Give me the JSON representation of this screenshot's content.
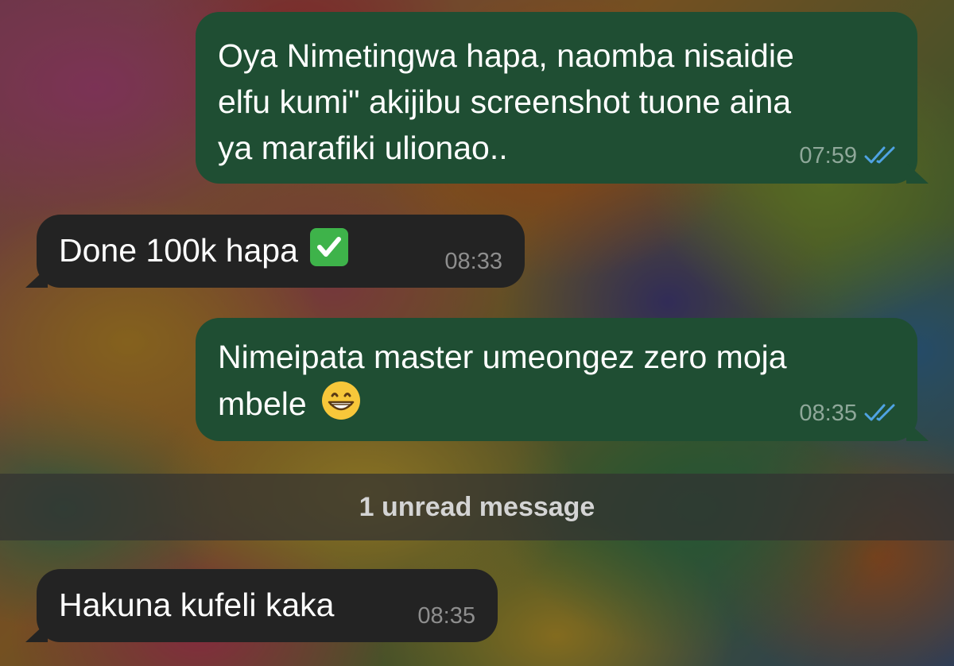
{
  "messages": [
    {
      "direction": "outgoing",
      "text": "Oya Nimetingwa hapa, naomba nisaidie\nelfu kumi\" akijibu screenshot tuone aina\nya marafiki ulionao..",
      "time": "07:59",
      "status": "read"
    },
    {
      "direction": "incoming",
      "text": "Done  100k hapa",
      "emoji": "check-mark-button",
      "time": "08:33"
    },
    {
      "direction": "outgoing",
      "text": "Nimeipata master umeongez zero moja\nmbele",
      "emoji": "grinning-face",
      "time": "08:35",
      "status": "read"
    },
    {
      "direction": "incoming",
      "text": "Hakuna kufeli kaka",
      "time": "08:35"
    }
  ],
  "unread_divider": {
    "label": "1 unread message"
  },
  "colors": {
    "outgoing_bubble": "#1f4e33",
    "incoming_bubble": "#232323",
    "read_ticks": "#4fa3e3"
  }
}
